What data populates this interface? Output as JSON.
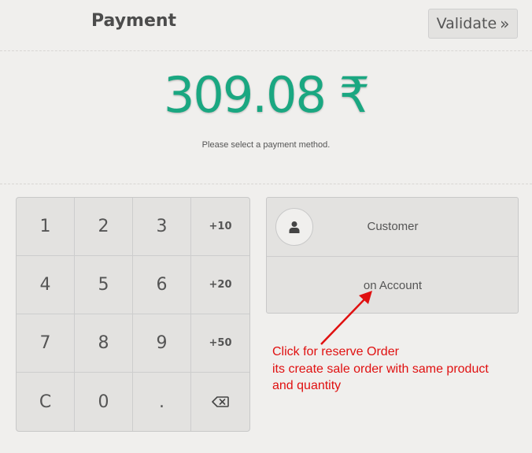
{
  "header": {
    "title": "Payment",
    "validate_label": "Validate",
    "validate_icon": "double-chevron-right-icon"
  },
  "amount": "309.08 ₹",
  "hint": "Please select a payment method.",
  "numpad": {
    "keys": [
      [
        "1",
        "2",
        "3",
        "+10"
      ],
      [
        "4",
        "5",
        "6",
        "+20"
      ],
      [
        "7",
        "8",
        "9",
        "+50"
      ],
      [
        "C",
        "0",
        ".",
        "backspace-icon"
      ]
    ]
  },
  "payment_methods": {
    "customer_label": "Customer",
    "customer_icon": "user-icon",
    "account_label": "on Account"
  },
  "annotation": {
    "lines": [
      "Click for reserve Order",
      "its create sale order with same product",
      "and quantity"
    ],
    "color": "#e01010"
  },
  "colors": {
    "accent": "#1aa781",
    "background": "#f0efed",
    "button_bg": "#e3e2e0"
  }
}
